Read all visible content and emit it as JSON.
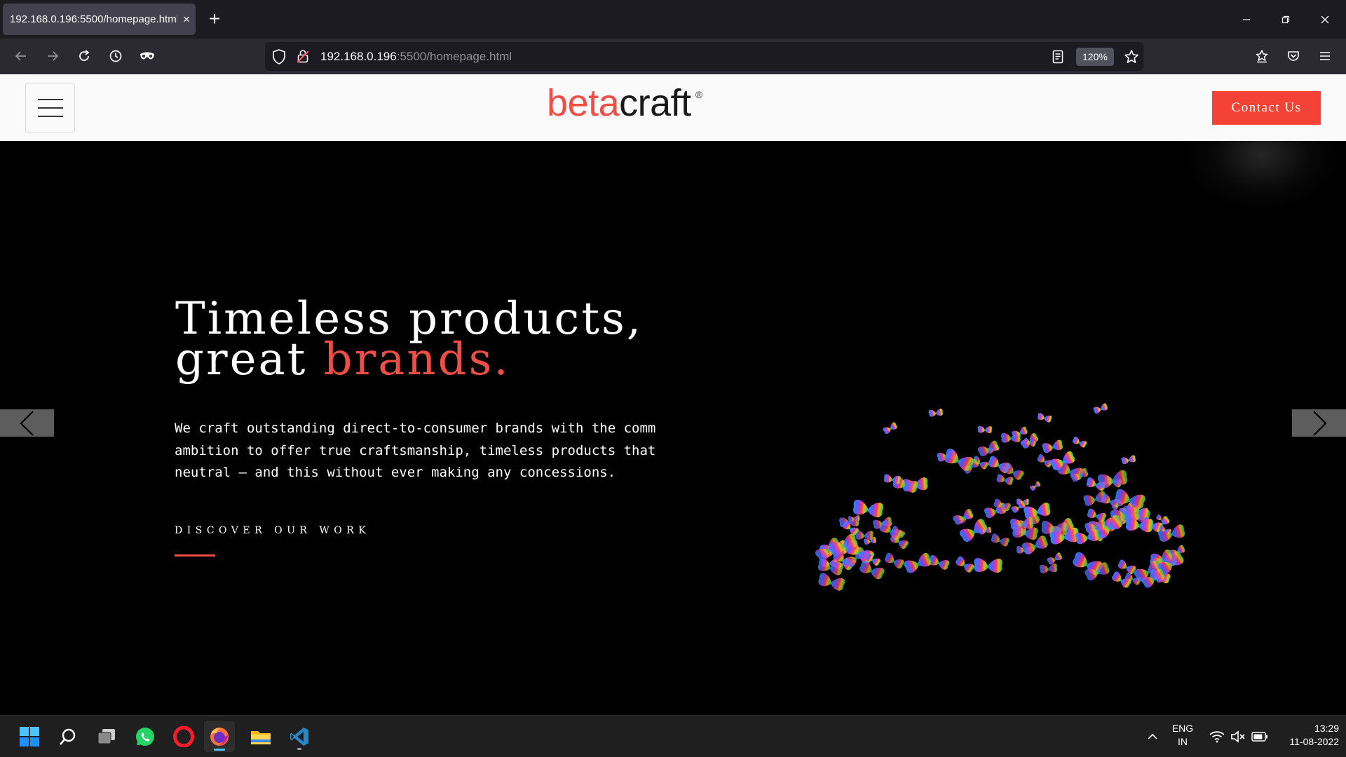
{
  "browser": {
    "tab_title": "192.168.0.196:5500/homepage.html",
    "tab_close": "×",
    "new_tab": "+",
    "url_host": "192.168.0.196",
    "url_rest": ":5500/homepage.html",
    "zoom": "120%"
  },
  "site": {
    "logo_beta": "beta",
    "logo_craft": "craft",
    "logo_reg": "®",
    "contact_label": "Contact Us",
    "headline_line1": "Timeless products,",
    "headline_line2_prefix": "great ",
    "headline_line2_accent": "brands.",
    "copy_line1": "We craft outstanding direct-to-consumer brands with the comm",
    "copy_line2": "ambition to offer true craftsmanship, timeless products that",
    "copy_line3": "neutral – and this without ever making any concessions.",
    "discover_label": "DISCOVER OUR WORK",
    "colors": {
      "accent": "#f04e45",
      "button": "#f44336",
      "hero_bg": "#000000",
      "header_bg": "#fafafa"
    }
  },
  "taskbar": {
    "apps": [
      "windows-start",
      "search",
      "task-view",
      "whatsapp",
      "opera",
      "firefox",
      "file-explorer",
      "vscode"
    ],
    "language_line1": "ENG",
    "language_line2": "IN",
    "time": "13:29",
    "date": "11-08-2022"
  }
}
